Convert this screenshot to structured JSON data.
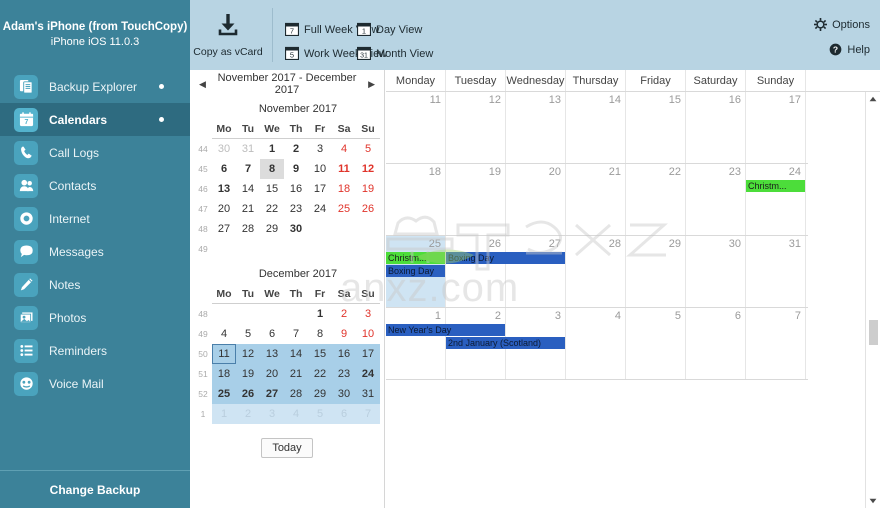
{
  "device": {
    "name": "Adam's iPhone (from TouchCopy)",
    "os": "iPhone iOS 11.0.3"
  },
  "toolbar": {
    "copy_vcard": "Copy as vCard",
    "views": [
      {
        "label": "Full Week View",
        "icon": "calendar-7-icon",
        "badge": "7"
      },
      {
        "label": "Day View",
        "icon": "calendar-1-icon",
        "badge": "1"
      },
      {
        "label": "Work Week View",
        "icon": "calendar-5-icon",
        "badge": "5"
      },
      {
        "label": "Month View",
        "icon": "calendar-31-icon",
        "badge": "31"
      }
    ],
    "options": "Options",
    "help": "Help"
  },
  "sidebar": {
    "items": [
      {
        "label": "Backup Explorer",
        "icon": "documents-icon",
        "active": false,
        "dot": true
      },
      {
        "label": "Calendars",
        "icon": "calendar-icon",
        "active": true,
        "dot": true
      },
      {
        "label": "Call Logs",
        "icon": "phone-icon",
        "active": false,
        "dot": false
      },
      {
        "label": "Contacts",
        "icon": "contacts-icon",
        "active": false,
        "dot": false
      },
      {
        "label": "Internet",
        "icon": "safari-icon",
        "active": false,
        "dot": false
      },
      {
        "label": "Messages",
        "icon": "message-bubble-icon",
        "active": false,
        "dot": false
      },
      {
        "label": "Notes",
        "icon": "pencil-icon",
        "active": false,
        "dot": false
      },
      {
        "label": "Photos",
        "icon": "photos-icon",
        "active": false,
        "dot": false
      },
      {
        "label": "Reminders",
        "icon": "list-icon",
        "active": false,
        "dot": false
      },
      {
        "label": "Voice Mail",
        "icon": "voicemail-icon",
        "active": false,
        "dot": false
      }
    ],
    "change_backup": "Change Backup"
  },
  "datepanel": {
    "range_label": "November 2017 - December 2017",
    "prev_icon": "chevron-left-icon",
    "next_icon": "chevron-right-icon",
    "today_button": "Today",
    "dow": [
      "Mo",
      "Tu",
      "We",
      "Th",
      "Fr",
      "Sa",
      "Su"
    ],
    "months": [
      {
        "title": "November 2017",
        "weeks": [
          {
            "num": "44",
            "days": [
              {
                "n": "30",
                "state": "mute"
              },
              {
                "n": "31",
                "state": "mute"
              },
              {
                "n": "1",
                "state": "bold"
              },
              {
                "n": "2",
                "state": "bold"
              },
              {
                "n": "3",
                "state": ""
              },
              {
                "n": "4",
                "state": "red"
              },
              {
                "n": "5",
                "state": "red"
              }
            ]
          },
          {
            "num": "45",
            "days": [
              {
                "n": "6",
                "state": "bold"
              },
              {
                "n": "7",
                "state": "bold"
              },
              {
                "n": "8",
                "state": "bold today"
              },
              {
                "n": "9",
                "state": "bold"
              },
              {
                "n": "10",
                "state": ""
              },
              {
                "n": "11",
                "state": "red bold"
              },
              {
                "n": "12",
                "state": "red bold"
              }
            ]
          },
          {
            "num": "46",
            "days": [
              {
                "n": "13",
                "state": "bold"
              },
              {
                "n": "14",
                "state": ""
              },
              {
                "n": "15",
                "state": ""
              },
              {
                "n": "16",
                "state": ""
              },
              {
                "n": "17",
                "state": ""
              },
              {
                "n": "18",
                "state": "red"
              },
              {
                "n": "19",
                "state": "red"
              }
            ]
          },
          {
            "num": "47",
            "days": [
              {
                "n": "20",
                "state": ""
              },
              {
                "n": "21",
                "state": ""
              },
              {
                "n": "22",
                "state": ""
              },
              {
                "n": "23",
                "state": ""
              },
              {
                "n": "24",
                "state": ""
              },
              {
                "n": "25",
                "state": "red"
              },
              {
                "n": "26",
                "state": "red"
              }
            ]
          },
          {
            "num": "48",
            "days": [
              {
                "n": "27",
                "state": ""
              },
              {
                "n": "28",
                "state": ""
              },
              {
                "n": "29",
                "state": ""
              },
              {
                "n": "30",
                "state": "bold"
              },
              {
                "n": "",
                "state": ""
              },
              {
                "n": "",
                "state": ""
              },
              {
                "n": "",
                "state": ""
              }
            ]
          },
          {
            "num": "49",
            "days": [
              {
                "n": "",
                "state": ""
              },
              {
                "n": "",
                "state": ""
              },
              {
                "n": "",
                "state": ""
              },
              {
                "n": "",
                "state": ""
              },
              {
                "n": "",
                "state": ""
              },
              {
                "n": "",
                "state": ""
              },
              {
                "n": "",
                "state": ""
              }
            ]
          }
        ]
      },
      {
        "title": "December 2017",
        "weeks": [
          {
            "num": "48",
            "days": [
              {
                "n": "",
                "state": ""
              },
              {
                "n": "",
                "state": ""
              },
              {
                "n": "",
                "state": ""
              },
              {
                "n": "",
                "state": ""
              },
              {
                "n": "1",
                "state": "bold"
              },
              {
                "n": "2",
                "state": "red"
              },
              {
                "n": "3",
                "state": "red"
              }
            ]
          },
          {
            "num": "49",
            "days": [
              {
                "n": "4",
                "state": ""
              },
              {
                "n": "5",
                "state": ""
              },
              {
                "n": "6",
                "state": ""
              },
              {
                "n": "7",
                "state": ""
              },
              {
                "n": "8",
                "state": ""
              },
              {
                "n": "9",
                "state": "red"
              },
              {
                "n": "10",
                "state": "red"
              }
            ]
          },
          {
            "num": "50",
            "days": [
              {
                "n": "11",
                "state": "sel selbox"
              },
              {
                "n": "12",
                "state": "sel"
              },
              {
                "n": "13",
                "state": "sel"
              },
              {
                "n": "14",
                "state": "sel"
              },
              {
                "n": "15",
                "state": "sel"
              },
              {
                "n": "16",
                "state": "sel"
              },
              {
                "n": "17",
                "state": "sel"
              }
            ]
          },
          {
            "num": "51",
            "days": [
              {
                "n": "18",
                "state": "sel"
              },
              {
                "n": "19",
                "state": "sel"
              },
              {
                "n": "20",
                "state": "sel"
              },
              {
                "n": "21",
                "state": "sel"
              },
              {
                "n": "22",
                "state": "sel"
              },
              {
                "n": "23",
                "state": "sel"
              },
              {
                "n": "24",
                "state": "sel bold"
              }
            ]
          },
          {
            "num": "52",
            "days": [
              {
                "n": "25",
                "state": "sel bold"
              },
              {
                "n": "26",
                "state": "sel bold"
              },
              {
                "n": "27",
                "state": "sel bold"
              },
              {
                "n": "28",
                "state": "sel"
              },
              {
                "n": "29",
                "state": "sel"
              },
              {
                "n": "30",
                "state": "sel"
              },
              {
                "n": "31",
                "state": "sel"
              }
            ]
          },
          {
            "num": "1",
            "days": [
              {
                "n": "1",
                "state": "sel mute"
              },
              {
                "n": "2",
                "state": "sel mute"
              },
              {
                "n": "3",
                "state": "sel mute"
              },
              {
                "n": "4",
                "state": "sel mute"
              },
              {
                "n": "5",
                "state": "sel mute"
              },
              {
                "n": "6",
                "state": "sel mute"
              },
              {
                "n": "7",
                "state": "sel mute"
              }
            ]
          }
        ]
      }
    ]
  },
  "calendar": {
    "dow_headers": [
      "Monday",
      "Tuesday",
      "Wednesday",
      "Thursday",
      "Friday",
      "Saturday",
      "Sunday"
    ],
    "weeks": [
      {
        "days": [
          {
            "n": "11",
            "sel": false
          },
          {
            "n": "12",
            "sel": false
          },
          {
            "n": "13",
            "sel": false
          },
          {
            "n": "14",
            "sel": false
          },
          {
            "n": "15",
            "sel": false
          },
          {
            "n": "16",
            "sel": false
          },
          {
            "n": "17",
            "sel": false
          }
        ],
        "events": []
      },
      {
        "days": [
          {
            "n": "18",
            "sel": false
          },
          {
            "n": "19",
            "sel": false
          },
          {
            "n": "20",
            "sel": false
          },
          {
            "n": "21",
            "sel": false
          },
          {
            "n": "22",
            "sel": false
          },
          {
            "n": "23",
            "sel": false
          },
          {
            "n": "24",
            "sel": false
          }
        ],
        "events": [
          {
            "title": "Christm...",
            "color": "green",
            "start": 6,
            "span": 1,
            "row": 0
          }
        ]
      },
      {
        "days": [
          {
            "n": "25",
            "sel": true
          },
          {
            "n": "26",
            "sel": false
          },
          {
            "n": "27",
            "sel": false
          },
          {
            "n": "28",
            "sel": false
          },
          {
            "n": "29",
            "sel": false
          },
          {
            "n": "30",
            "sel": false
          },
          {
            "n": "31",
            "sel": false
          }
        ],
        "events": [
          {
            "title": "Christm...",
            "color": "green",
            "start": 0,
            "span": 1,
            "row": 0
          },
          {
            "title": "Boxing Day",
            "color": "blue",
            "start": 1,
            "span": 2,
            "row": 0
          },
          {
            "title": "Boxing Day",
            "color": "blue",
            "start": 0,
            "span": 1,
            "row": 1
          }
        ]
      },
      {
        "days": [
          {
            "n": "1",
            "sel": false
          },
          {
            "n": "2",
            "sel": false
          },
          {
            "n": "3",
            "sel": false
          },
          {
            "n": "4",
            "sel": false
          },
          {
            "n": "5",
            "sel": false
          },
          {
            "n": "6",
            "sel": false
          },
          {
            "n": "7",
            "sel": false
          }
        ],
        "events": [
          {
            "title": "New Year's Day",
            "color": "blue",
            "start": 0,
            "span": 2,
            "row": 0
          },
          {
            "title": "2nd January (Scotland)",
            "color": "blue",
            "start": 1,
            "span": 2,
            "row": 1
          }
        ]
      }
    ],
    "scroll": {
      "up_icon": "scroll-up-arrow-icon",
      "down_icon": "scroll-down-arrow-icon"
    }
  },
  "watermark": {
    "text": "anxz.com"
  },
  "colors": {
    "brand_teal": "#3c8299",
    "topbar_blue": "#b8d4e3",
    "event_green": "#4cdd3a",
    "event_blue": "#2a5fc0",
    "selection_blue": "#cfe4f3",
    "weekend_red": "#e0342b"
  }
}
